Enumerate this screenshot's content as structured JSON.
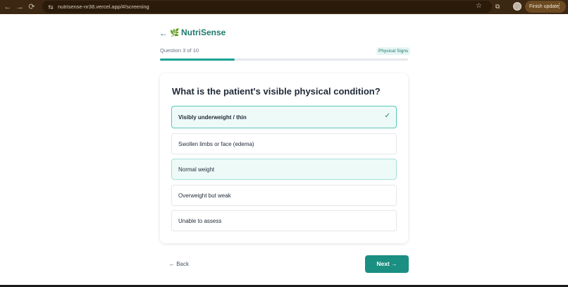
{
  "browser": {
    "url": "nutrisense-nr38.vercel.app/#/screening",
    "finish_update": "Finish update",
    "back_glyph": "←",
    "forward_glyph": "→",
    "reload_glyph": "⟳",
    "star_glyph": "☆",
    "ext_glyph": "⧉",
    "site_glyph": "⇆",
    "menu_glyph": "⋮"
  },
  "app": {
    "back_arrow": "←",
    "brand_icon": "🌿",
    "brand": "NutriSense"
  },
  "progress": {
    "label": "Question 3 of 10",
    "section": "Physical Signs",
    "fraction": 0.3
  },
  "question": {
    "text": "What is the patient's visible physical condition?",
    "check_glyph": "✓",
    "options": [
      {
        "label": "Visibly underweight / thin",
        "state": "selected"
      },
      {
        "label": "Swollen limbs or face (edema)",
        "state": "default"
      },
      {
        "label": "Normal weight",
        "state": "hover"
      },
      {
        "label": "Overweight but weak",
        "state": "default"
      },
      {
        "label": "Unable to assess",
        "state": "default"
      }
    ]
  },
  "footer": {
    "back_label": "← Back",
    "next_label": "Next →"
  },
  "colors": {
    "accent": "#1a8f82",
    "brand_text": "#1f7a6e",
    "selected_bg": "#eefaf8",
    "chrome_bg": "#3b2712"
  }
}
